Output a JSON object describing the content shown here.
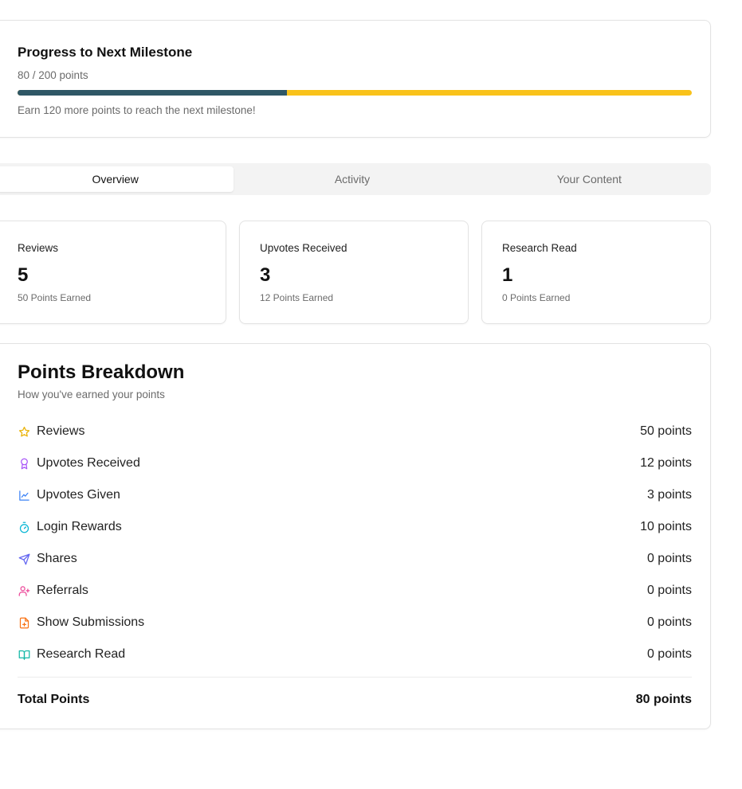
{
  "milestone": {
    "title": "Progress to Next Milestone",
    "progress_text": "80 / 200 points",
    "current": 80,
    "target": 200,
    "hint": "Earn 120 more points to reach the next milestone!",
    "colors": {
      "fill": "#2f5766",
      "remaining": "#f9c21a"
    }
  },
  "tabs": [
    {
      "label": "Overview",
      "active": true
    },
    {
      "label": "Activity",
      "active": false
    },
    {
      "label": "Your Content",
      "active": false
    }
  ],
  "stats": [
    {
      "label": "Reviews",
      "value": "5",
      "earned": "50 Points Earned"
    },
    {
      "label": "Upvotes Received",
      "value": "3",
      "earned": "12 Points Earned"
    },
    {
      "label": "Research Read",
      "value": "1",
      "earned": "0 Points Earned"
    }
  ],
  "breakdown": {
    "title": "Points Breakdown",
    "subtitle": "How you've earned your points",
    "items": [
      {
        "label": "Reviews",
        "points": "50 points",
        "icon": "star-icon",
        "color": "#eab308"
      },
      {
        "label": "Upvotes Received",
        "points": "12 points",
        "icon": "award-icon",
        "color": "#a855f7"
      },
      {
        "label": "Upvotes Given",
        "points": "3 points",
        "icon": "line-chart-icon",
        "color": "#3b82f6"
      },
      {
        "label": "Login Rewards",
        "points": "10 points",
        "icon": "timer-icon",
        "color": "#06b6d4"
      },
      {
        "label": "Shares",
        "points": "0 points",
        "icon": "send-icon",
        "color": "#6366f1"
      },
      {
        "label": "Referrals",
        "points": "0 points",
        "icon": "user-plus-icon",
        "color": "#ec4899"
      },
      {
        "label": "Show Submissions",
        "points": "0 points",
        "icon": "file-plus-icon",
        "color": "#f97316"
      },
      {
        "label": "Research Read",
        "points": "0 points",
        "icon": "book-open-icon",
        "color": "#14b8a6"
      }
    ],
    "total_label": "Total Points",
    "total_value": "80 points"
  }
}
